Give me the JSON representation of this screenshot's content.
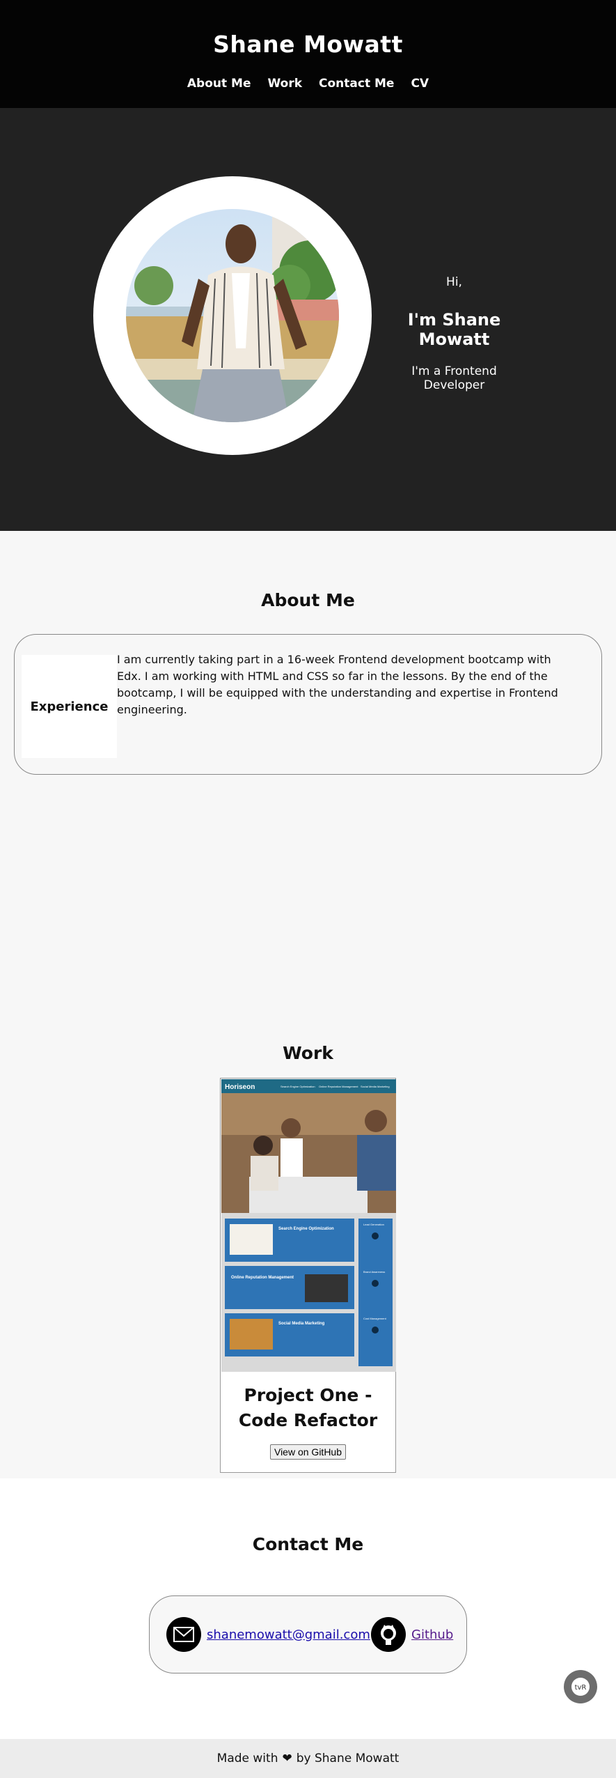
{
  "header": {
    "title": "Shane Mowatt",
    "nav": [
      "About Me",
      "Work",
      "Contact Me",
      "CV"
    ]
  },
  "hero": {
    "greeting": "Hi,",
    "name": "I'm Shane Mowatt",
    "role": "I'm a Frontend Developer"
  },
  "about": {
    "title": "About Me",
    "label": "Experience",
    "text": "I am currently taking part in a 16-week Frontend development bootcamp with Edx. I am working with HTML and CSS so far in the lessons. By the end of the bootcamp, I will be equipped with the understanding and expertise in Frontend engineering."
  },
  "work": {
    "title": "Work",
    "project": {
      "title": "Project One - Code Refactor",
      "button": "View on GitHub",
      "screenshot": {
        "logo": "Horiseon",
        "nav": [
          "Search Engine Optimization",
          "Online Reputation Management",
          "Social Media Marketing"
        ],
        "sections": [
          "Search Engine Optimization",
          "Online Reputation Management",
          "Social Media Marketing"
        ],
        "sidebar": [
          "Lead Generation",
          "Brand Awareness",
          "Cost Management"
        ]
      }
    }
  },
  "contact": {
    "title": "Contact Me",
    "email": "shanemowatt@gmail.com",
    "github": "Github",
    "chat_label": "tvR"
  },
  "footer": {
    "pre": "Made with",
    "post": "by Shane Mowatt"
  },
  "colors": {
    "header_bg": "#040404",
    "hero_bg": "#222222",
    "page_bg": "#f7f7f7",
    "screenshot_blue": "#2e74b5",
    "screenshot_teal": "#1f6a85"
  }
}
